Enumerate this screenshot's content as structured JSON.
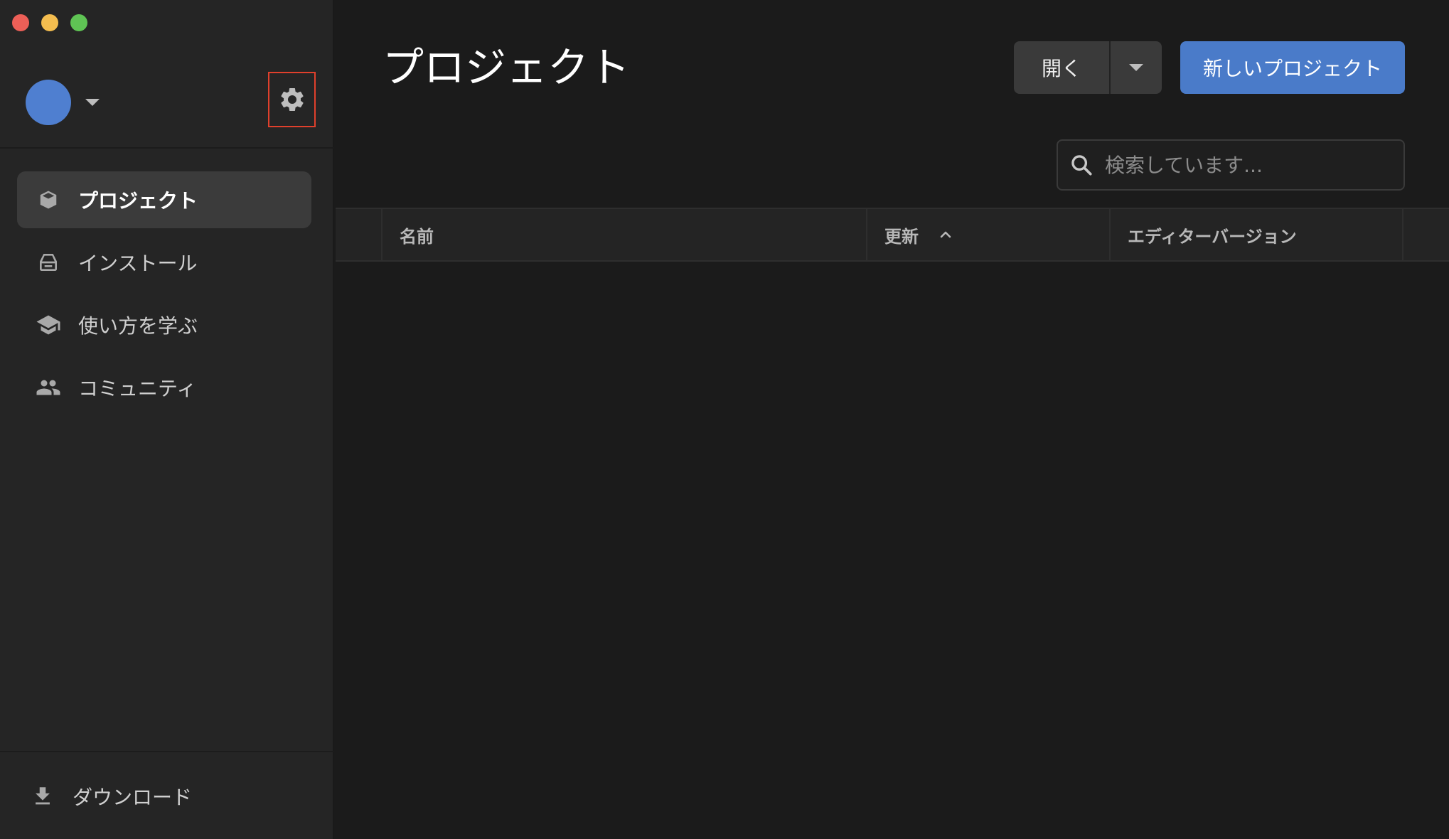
{
  "sidebar": {
    "settings_icon": "gear-icon",
    "items": [
      {
        "label": "プロジェクト",
        "icon": "cube-icon",
        "active": true
      },
      {
        "label": "インストール",
        "icon": "drive-icon",
        "active": false
      },
      {
        "label": "使い方を学ぶ",
        "icon": "graduation-cap-icon",
        "active": false
      },
      {
        "label": "コミュニティ",
        "icon": "people-icon",
        "active": false
      }
    ],
    "download_label": "ダウンロード"
  },
  "main": {
    "title": "プロジェクト",
    "open_label": "開く",
    "new_project_label": "新しいプロジェクト",
    "search": {
      "placeholder": "検索しています..."
    },
    "table": {
      "columns": {
        "name": "名前",
        "updated": "更新",
        "version": "エディターバージョン"
      }
    }
  },
  "colors": {
    "accent": "#4a7bc9",
    "avatar": "#4f7fd0",
    "highlight": "#e0402c"
  }
}
